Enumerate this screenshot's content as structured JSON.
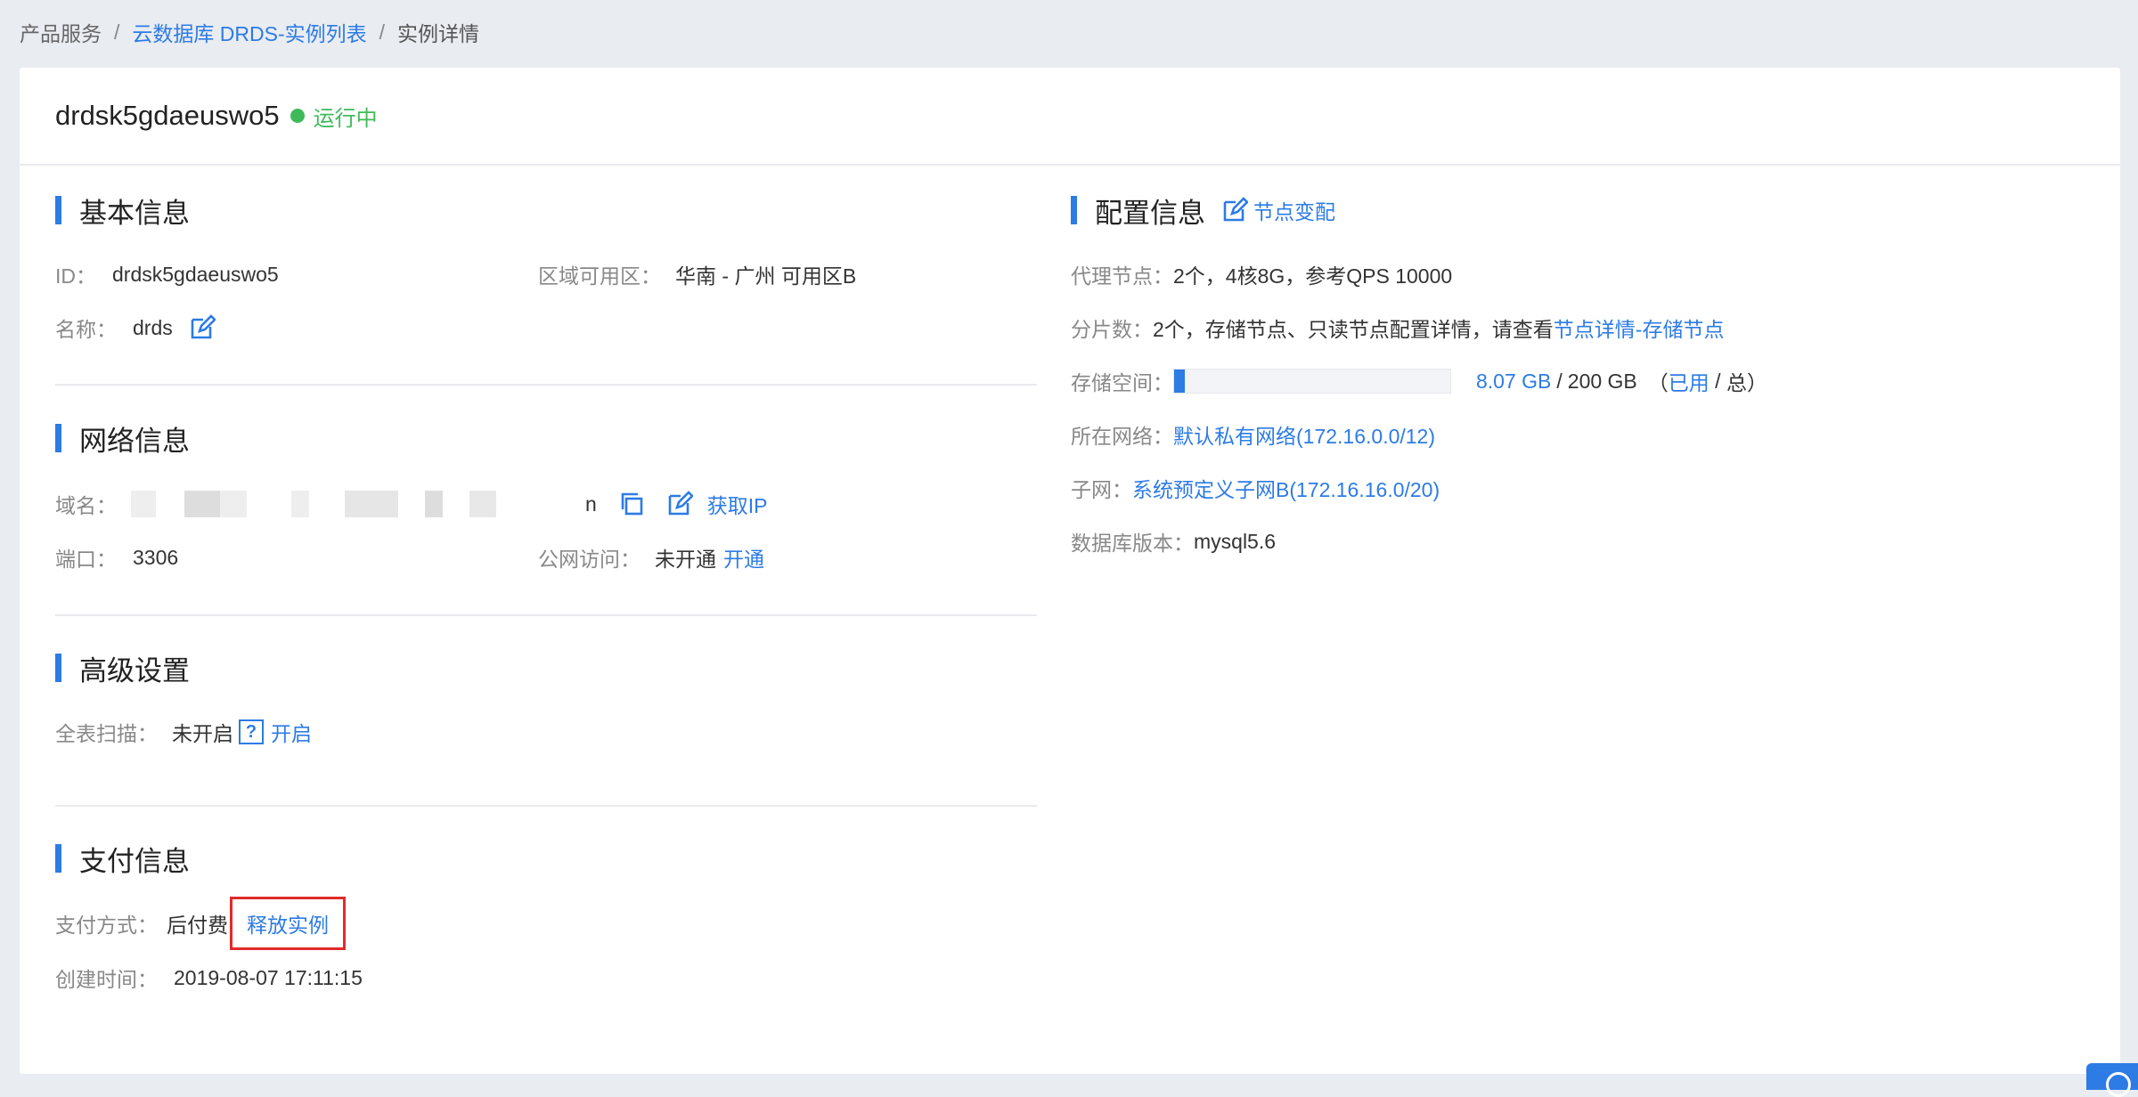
{
  "breadcrumb": {
    "items": [
      "产品服务",
      "云数据库 DRDS-实例列表",
      "实例详情"
    ],
    "sep": "/"
  },
  "instance": {
    "name": "drdsk5gdaeuswo5",
    "status": "运行中",
    "status_color": "#3fba5a"
  },
  "basic": {
    "title": "基本信息",
    "id_label": "ID：",
    "id_value": "drdsk5gdaeuswo5",
    "zone_label": "区域可用区：",
    "zone_value": "华南 - 广州 可用区B",
    "name_label": "名称：",
    "name_value": "drds"
  },
  "network": {
    "title": "网络信息",
    "domain_label": "域名：",
    "domain_tail": "n",
    "get_ip": "获取IP",
    "port_label": "端口：",
    "port_value": "3306",
    "public_label": "公网访问：",
    "public_value": "未开通",
    "public_action": "开通"
  },
  "advanced": {
    "title": "高级设置",
    "scan_label": "全表扫描：",
    "scan_value": "未开启",
    "scan_action": "开启",
    "help": "?"
  },
  "payment": {
    "title": "支付信息",
    "method_label": "支付方式：",
    "method_value": "后付费",
    "release": "释放实例",
    "created_label": "创建时间：",
    "created_value": "2019-08-07 17:11:15"
  },
  "config": {
    "title": "配置信息",
    "change_action": "节点变配",
    "proxy_label": "代理节点：",
    "proxy_value": "2个，4核8G，参考QPS 10000",
    "shard_label": "分片数：",
    "shard_value": "2个，存储节点、只读节点配置详情，请查看",
    "shard_link": "节点详情-存储节点",
    "storage_label": "存储空间：",
    "storage_used": "8.07 GB",
    "storage_slash": "/",
    "storage_total": "200 GB",
    "storage_legend_open": "（",
    "storage_legend_used": "已用",
    "storage_legend_sep": " / ",
    "storage_legend_total": "总）",
    "storage_fraction": 0.04,
    "network_label": "所在网络：",
    "network_value": "默认私有网络(172.16.0.0/12)",
    "subnet_label": "子网：",
    "subnet_value": "系统预定义子网B(172.16.16.0/20)",
    "db_label": "数据库版本：",
    "db_value": "mysql5.6"
  },
  "colors": {
    "accent": "#2d7be5",
    "highlight_border": "#e02b2b"
  }
}
